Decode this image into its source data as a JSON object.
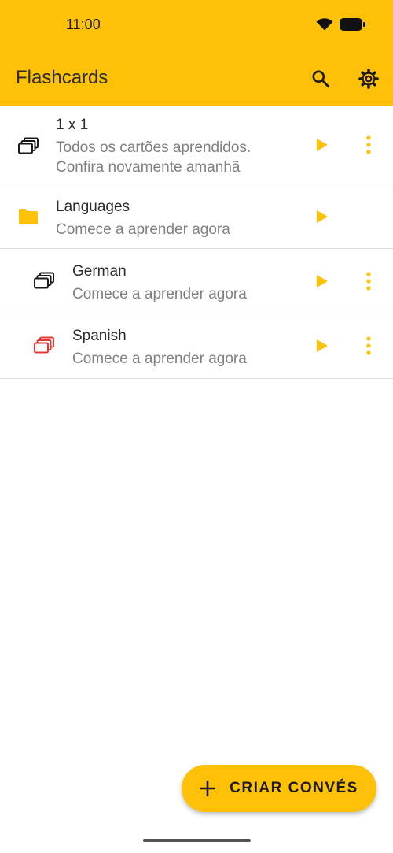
{
  "status_bar": {
    "time": "11:00"
  },
  "app_bar": {
    "title": "Flashcards",
    "search_icon": "search-icon",
    "settings_icon": "gear-icon",
    "background_color": "#FFC107"
  },
  "decks": [
    {
      "title": "1 x 1",
      "subtitle_line1": "Todos os cartões aprendidos.",
      "subtitle_line2": "Confira novamente amanhã",
      "icon": "deck-icon",
      "icon_color": "#1a1a1a",
      "has_menu": true
    },
    {
      "title": "Languages",
      "subtitle_line1": "Comece a aprender agora",
      "icon": "folder-icon",
      "icon_color": "#FFC107",
      "has_menu": false
    },
    {
      "title": "German",
      "subtitle_line1": "Comece a aprender agora",
      "icon": "deck-icon",
      "icon_color": "#1a1a1a",
      "has_menu": true
    },
    {
      "title": "Spanish",
      "subtitle_line1": "Comece a aprender agora",
      "icon": "deck-icon",
      "icon_color": "#E53935",
      "has_menu": true
    }
  ],
  "fab": {
    "label": "CRIAR CONVÉS",
    "icon": "plus-icon"
  },
  "colors": {
    "accent": "#FFC107",
    "muted_text": "#808080",
    "danger": "#E53935"
  }
}
